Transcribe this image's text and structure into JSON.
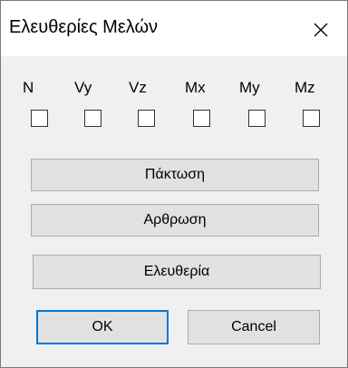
{
  "window": {
    "title": "Ελευθερίες Μελών",
    "close_icon": "close-icon"
  },
  "dofs": [
    {
      "label": "N",
      "checked": false
    },
    {
      "label": "Vy",
      "checked": false
    },
    {
      "label": "Vz",
      "checked": false
    },
    {
      "label": "Mx",
      "checked": false
    },
    {
      "label": "My",
      "checked": false
    },
    {
      "label": "Mz",
      "checked": false
    }
  ],
  "buttons": {
    "fixed": "Πάκτωση",
    "hinge": "Αρθρωση",
    "free": "Ελευθερία",
    "ok": "OK",
    "cancel": "Cancel"
  }
}
